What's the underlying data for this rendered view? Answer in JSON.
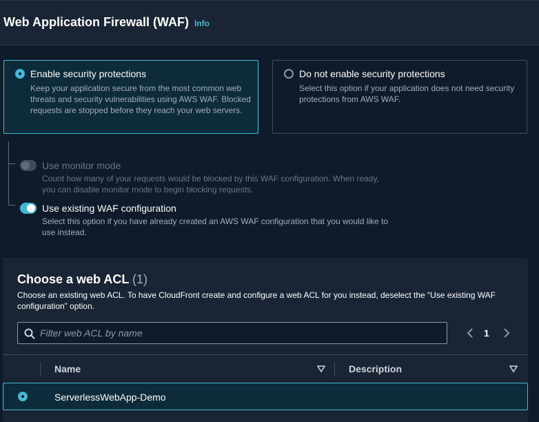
{
  "header": {
    "title": "Web Application Firewall (WAF)",
    "info": "Info"
  },
  "protection_options": [
    {
      "title": "Enable security protections",
      "description": "Keep your application secure from the most common web threats and security vulnerabilities using AWS WAF. Blocked requests are stopped before they reach your web servers.",
      "selected": true
    },
    {
      "title": "Do not enable security protections",
      "description": "Select this option if your application does not need security protections from AWS WAF.",
      "selected": false
    }
  ],
  "monitor_mode": {
    "title": "Use monitor mode",
    "description": "Count how many of your requests would be blocked by this WAF configuration. When ready, you can disable monitor mode to begin blocking requests.",
    "enabled": false,
    "disabled": true
  },
  "existing_waf": {
    "title": "Use existing WAF configuration",
    "description": "Select this option if you have already created an AWS WAF configuration that you would like to use instead.",
    "enabled": true
  },
  "acl_panel": {
    "title": "Choose a web ACL",
    "count": "(1)",
    "description": "Choose an existing web ACL. To have CloudFront create and configure a web ACL for you instead, deselect the “Use existing WAF configuration” option.",
    "search_placeholder": "Filter web ACL by name",
    "page": "1",
    "columns": [
      "Name",
      "Description"
    ],
    "rows": [
      {
        "name": "ServerlessWebApp-Demo",
        "description": "",
        "selected": true
      }
    ]
  },
  "colors": {
    "accent": "#44b9d6",
    "background": "#0f1b2a",
    "panel": "#192534"
  }
}
